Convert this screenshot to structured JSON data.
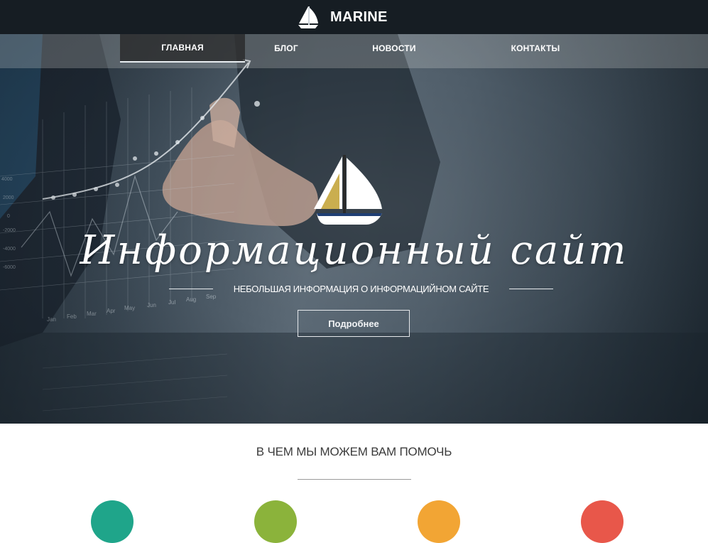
{
  "header": {
    "brand_name": "MARINE",
    "logo_icon": "sailboat-icon"
  },
  "nav": {
    "items": [
      {
        "label": "ГЛАВНАЯ",
        "active": true
      },
      {
        "label": "БЛОГ",
        "active": false
      },
      {
        "label": "НОВОСТИ",
        "active": false
      },
      {
        "label": "КОНТАКТЫ",
        "active": false
      }
    ]
  },
  "hero": {
    "logo_icon": "sailboat-icon",
    "title": "Информационный сайт",
    "subtitle": "НЕБОЛЬШАЯ ИНФОРМАЦИЯ О ИНФОРМАЦИЙНОМ САЙТЕ",
    "button_label": "Подробнее"
  },
  "services": {
    "title": "В ЧЕМ МЫ МОЖЕМ ВАМ ПОМОЧЬ",
    "circle_colors": [
      "#1fa58a",
      "#8bb33b",
      "#f2a534",
      "#e8574a"
    ]
  },
  "colors": {
    "topbar": "#161d23",
    "nav_active": "#2a2a2a",
    "text_light": "#ffffff"
  }
}
